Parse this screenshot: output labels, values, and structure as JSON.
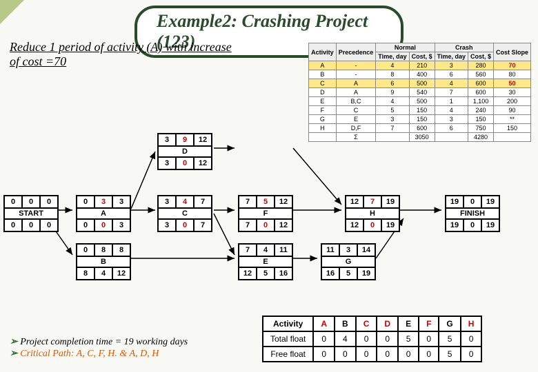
{
  "title": "Example2: Crashing Project (123)",
  "instruction": "Reduce 1 period of activity (A) with increase of cost =70",
  "table": {
    "headers": [
      "Activity",
      "Precedence",
      "Time, day",
      "Cost, $",
      "Time, day",
      "Cost, $",
      "Cost Slope"
    ],
    "groups": [
      "Normal",
      "Crash"
    ],
    "rows": [
      {
        "hl": true,
        "c": [
          "A",
          "-",
          "4",
          "210",
          "3",
          "280",
          "70"
        ]
      },
      {
        "c": [
          "B",
          "-",
          "8",
          "400",
          "6",
          "560",
          "80"
        ]
      },
      {
        "hl": true,
        "c": [
          "C",
          "A",
          "6",
          "500",
          "4",
          "600",
          "50"
        ]
      },
      {
        "c": [
          "D",
          "A",
          "9",
          "540",
          "7",
          "600",
          "30"
        ]
      },
      {
        "c": [
          "E",
          "B,C",
          "4",
          "500",
          "1",
          "1,100",
          "200"
        ]
      },
      {
        "c": [
          "F",
          "C",
          "5",
          "150",
          "4",
          "240",
          "90"
        ]
      },
      {
        "c": [
          "G",
          "E",
          "3",
          "150",
          "3",
          "150",
          "**"
        ]
      },
      {
        "c": [
          "H",
          "D,F",
          "7",
          "600",
          "6",
          "750",
          "150"
        ]
      },
      {
        "sum": true,
        "c": [
          "",
          "Σ",
          "",
          "3050",
          "",
          "4280",
          ""
        ]
      }
    ]
  },
  "nodes": {
    "START": {
      "lbl": "START",
      "t": [
        "0",
        "0",
        "0"
      ],
      "b": [
        "0",
        "0",
        "0"
      ]
    },
    "A": {
      "lbl": "A",
      "t": [
        "0",
        "3",
        "3"
      ],
      "b": [
        "0",
        "0",
        "3"
      ],
      "r": [
        1
      ]
    },
    "B": {
      "lbl": "B",
      "t": [
        "0",
        "8",
        "8"
      ],
      "b": [
        "8",
        "4",
        "12"
      ]
    },
    "C": {
      "lbl": "C",
      "t": [
        "3",
        "4",
        "7"
      ],
      "b": [
        "3",
        "0",
        "7"
      ],
      "r": [
        1
      ]
    },
    "D": {
      "lbl": "D",
      "t": [
        "3",
        "9",
        "12"
      ],
      "b": [
        "3",
        "0",
        "12"
      ],
      "r": [
        1
      ]
    },
    "E": {
      "lbl": "E",
      "t": [
        "7",
        "4",
        "11"
      ],
      "b": [
        "12",
        "5",
        "16"
      ]
    },
    "F": {
      "lbl": "F",
      "t": [
        "7",
        "5",
        "12"
      ],
      "b": [
        "7",
        "0",
        "12"
      ],
      "r": [
        1
      ]
    },
    "G": {
      "lbl": "G",
      "t": [
        "11",
        "3",
        "14"
      ],
      "b": [
        "16",
        "5",
        "19"
      ]
    },
    "H": {
      "lbl": "H",
      "t": [
        "12",
        "7",
        "19"
      ],
      "b": [
        "12",
        "0",
        "19"
      ],
      "r": [
        1
      ]
    },
    "FINISH": {
      "lbl": "FINISH",
      "t": [
        "19",
        "0",
        "19"
      ],
      "b": [
        "19",
        "0",
        "19"
      ]
    }
  },
  "bullets": [
    "Project completion time = 19 working days",
    "Critical Path: A, C, F, H. & A, D, H"
  ],
  "float": {
    "head": [
      "Activity",
      "A",
      "B",
      "C",
      "D",
      "E",
      "F",
      "G",
      "H"
    ],
    "tf": [
      "Total float",
      "0",
      "4",
      "0",
      "0",
      "5",
      "0",
      "5",
      "0"
    ],
    "ff": [
      "Free float",
      "0",
      "0",
      "0",
      "0",
      "0",
      "0",
      "5",
      "0"
    ],
    "red": [
      1,
      3,
      4,
      6,
      8
    ]
  }
}
